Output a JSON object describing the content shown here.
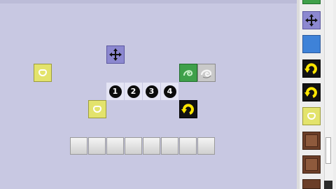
{
  "numbers": [
    "1",
    "2",
    "3",
    "4"
  ],
  "colors": {
    "background": "#c8c8e2",
    "yellow_block": "#e3e36c",
    "move_block": "#8c88d0",
    "green_block": "#3fa04a",
    "black_block": "#121212",
    "blue_block": "#3e82d8",
    "brown_block": "#6b3e28"
  },
  "canvas_blocks": [
    {
      "kind": "yellow-block",
      "icon": "rounded-square-icon"
    },
    {
      "kind": "move-block",
      "icon": "four-arrows-icon"
    },
    {
      "kind": "green-block",
      "icon": "swirl-icon"
    },
    {
      "kind": "gray-block",
      "icon": "swirl-icon"
    },
    {
      "kind": "black-block",
      "icon": "rotate-arrow-icon"
    }
  ],
  "palette_items": [
    "green-block",
    "move-block",
    "blue-block",
    "rotate-block",
    "rotate-block",
    "yellow-block",
    "brown-block",
    "brown-block"
  ]
}
